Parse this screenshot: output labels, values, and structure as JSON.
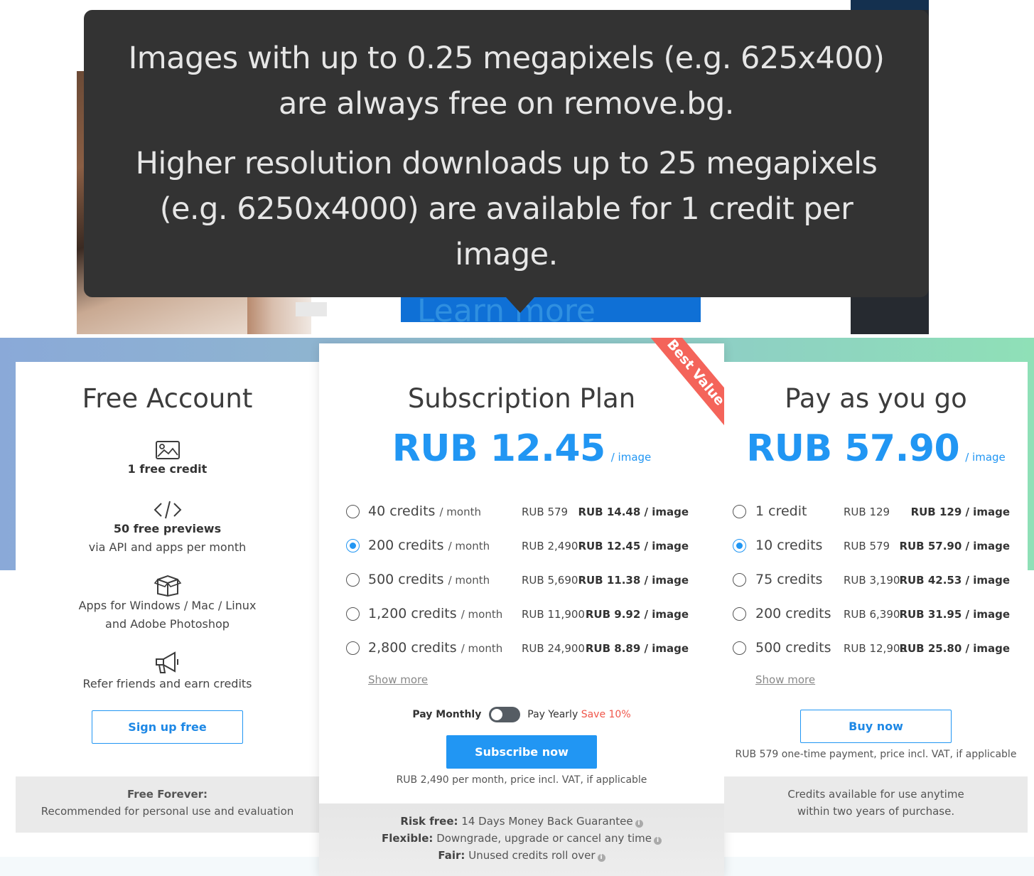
{
  "tooltip": {
    "line1": "Images with up to 0.25 megapixels (e.g. 625x400) are always free on remove.bg.",
    "line2": "Higher resolution downloads up to 25 megapixels (e.g. 6250x4000) are available for 1 credit per image.",
    "learn_more": "Learn more"
  },
  "free": {
    "title": "Free Account",
    "f1_bold": "1 free credit",
    "f2_bold": "50 free previews",
    "f2_text": "via API and apps per month",
    "f3_line1": "Apps for Windows / Mac / Linux",
    "f3_line2": "and Adobe Photoshop",
    "f4_text": "Refer friends and earn credits",
    "button": "Sign up free",
    "foot_bold": "Free Forever:",
    "foot_text": "Recommended for personal use and evaluation",
    "icons": [
      "image-icon",
      "code-icon",
      "box-icon",
      "megaphone-icon"
    ]
  },
  "sub": {
    "title": "Subscription Plan",
    "price": "RUB 12.45",
    "per": "/ image",
    "ribbon": "Best Value",
    "options": [
      {
        "label": "40 credits",
        "period": "/ month",
        "total": "RUB 579",
        "unit": "RUB 14.48 / image",
        "selected": false
      },
      {
        "label": "200 credits",
        "period": "/ month",
        "total": "RUB 2,490",
        "unit": "RUB 12.45 / image",
        "selected": true
      },
      {
        "label": "500 credits",
        "period": "/ month",
        "total": "RUB 5,690",
        "unit": "RUB 11.38 / image",
        "selected": false
      },
      {
        "label": "1,200 credits",
        "period": "/ month",
        "total": "RUB 11,900",
        "unit": "RUB 9.92 / image",
        "selected": false
      },
      {
        "label": "2,800 credits",
        "period": "/ month",
        "total": "RUB 24,900",
        "unit": "RUB 8.89 / image",
        "selected": false
      }
    ],
    "show_more": "Show more",
    "pay_monthly": "Pay Monthly",
    "pay_yearly": "Pay Yearly",
    "save": "Save 10%",
    "button": "Subscribe now",
    "note": "RUB 2,490 per month, price incl. VAT, if applicable",
    "foot": [
      {
        "bold": "Risk free:",
        "text": "14 Days Money Back Guarantee"
      },
      {
        "bold": "Flexible:",
        "text": "Downgrade, upgrade or cancel any time"
      },
      {
        "bold": "Fair:",
        "text": "Unused credits roll over"
      }
    ]
  },
  "payg": {
    "title": "Pay as you go",
    "price": "RUB 57.90",
    "per": "/ image",
    "options": [
      {
        "label": "1 credit",
        "total": "RUB 129",
        "unit": "RUB 129 / image",
        "selected": false
      },
      {
        "label": "10 credits",
        "total": "RUB 579",
        "unit": "RUB 57.90 / image",
        "selected": true
      },
      {
        "label": "75 credits",
        "total": "RUB 3,190",
        "unit": "RUB 42.53 / image",
        "selected": false
      },
      {
        "label": "200 credits",
        "total": "RUB 6,390",
        "unit": "RUB 31.95 / image",
        "selected": false
      },
      {
        "label": "500 credits",
        "total": "RUB 12,900",
        "unit": "RUB 25.80 / image",
        "selected": false
      }
    ],
    "show_more": "Show more",
    "button": "Buy now",
    "note": "RUB 579 one-time payment, price incl. VAT, if applicable",
    "foot_line1": "Credits available for use anytime",
    "foot_line2": "within two years of purchase."
  },
  "colors": {
    "accent": "#2196f3",
    "ribbon": "#f4645a",
    "tooltip_bg": "#333333",
    "link": "#2f8fe0"
  }
}
